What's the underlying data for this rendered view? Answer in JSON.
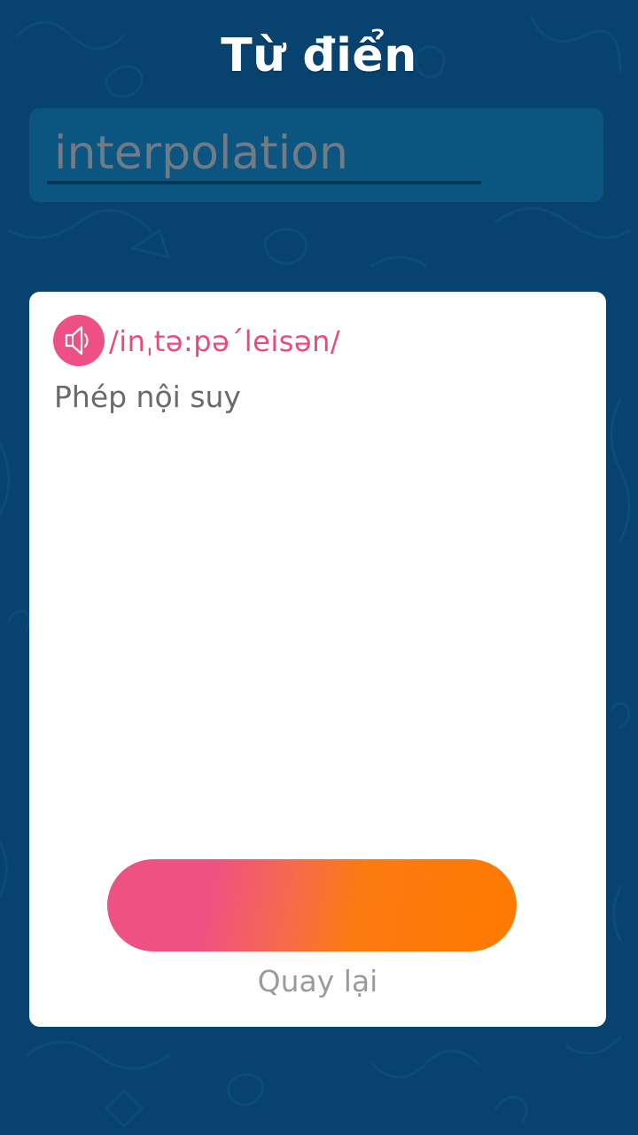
{
  "header": {
    "title": "Từ điển"
  },
  "search": {
    "value": "interpolation"
  },
  "entry": {
    "phonetic": "/inˌtə:pə´leisən/",
    "meaning": "Phép nội suy",
    "speaker_icon": "speaker-icon"
  },
  "actions": {
    "back_label": "Quay lại"
  },
  "colors": {
    "background": "#08426f",
    "search_box": "#0c5581",
    "accent_pink": "#ee4f84",
    "accent_orange": "#ff7a00",
    "card": "#ffffff"
  }
}
